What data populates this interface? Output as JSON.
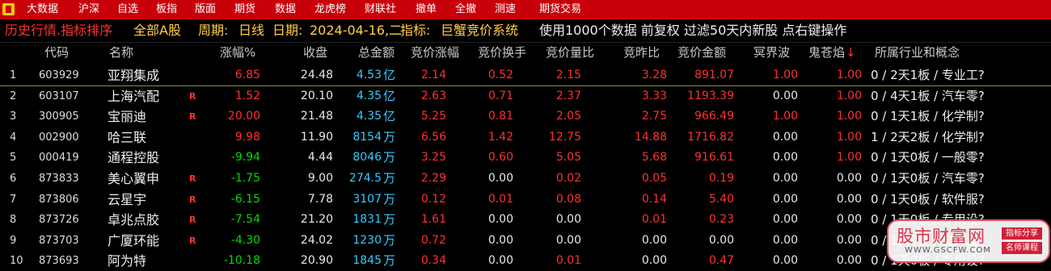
{
  "menu": [
    "大数据",
    "沪深",
    "自选",
    "板指",
    "版面",
    "期货",
    "数据",
    "龙虎榜",
    "财联社",
    "撤单",
    "全撤",
    "测速",
    "期货交易"
  ],
  "info": {
    "title": "历史行情.指标排序",
    "scope": "全部A股",
    "period_label": "周期:",
    "period_value": "日线",
    "date_label": "日期:",
    "date_value": "2024-04-16,二",
    "indicator_label": "指标:",
    "indicator_value": "巨蟹竞价系统",
    "usage": "使用1000个数据 前复权 过滤50天内新股 点右键操作"
  },
  "headers": {
    "code": "代码",
    "name": "名称",
    "change": "涨幅%",
    "close": "收盘",
    "amount": "总金额",
    "bid_change": "竞价涨幅",
    "bid_turnover": "竞价换手",
    "bid_volratio": "竞价量比",
    "bid_prevratio": "竞昨比",
    "bid_amount": "竞价金额",
    "wave": "冥界波",
    "flame": "鬼苍焰",
    "sort_arrow": "↓",
    "industry": "所属行业和概念"
  },
  "rows": [
    {
      "idx": "1",
      "code": "603929",
      "name": "亚翔集成",
      "r": "",
      "change": "6.85",
      "close": "24.48",
      "amount_num": "4.53",
      "amount_unit": "亿",
      "bid_change": "2.14",
      "bid_turnover": "0.52",
      "bid_volratio": "2.15",
      "bid_prevratio": "3.28",
      "bid_amount": "891.07",
      "wave": "1.00",
      "flame": "1.00",
      "industry": "0 / 2天1板 / 专业工?"
    },
    {
      "idx": "2",
      "code": "603107",
      "name": "上海汽配",
      "r": "R",
      "change": "1.52",
      "close": "20.10",
      "amount_num": "4.35",
      "amount_unit": "亿",
      "bid_change": "2.63",
      "bid_turnover": "0.71",
      "bid_volratio": "2.37",
      "bid_prevratio": "3.33",
      "bid_amount": "1193.39",
      "wave": "0.00",
      "flame": "1.00",
      "industry": "0 / 4天1板 / 汽车零?"
    },
    {
      "idx": "3",
      "code": "300905",
      "name": "宝丽迪",
      "r": "R",
      "change": "20.00",
      "close": "21.48",
      "amount_num": "4.35",
      "amount_unit": "亿",
      "bid_change": "5.25",
      "bid_turnover": "0.81",
      "bid_volratio": "2.05",
      "bid_prevratio": "2.75",
      "bid_amount": "966.49",
      "wave": "1.00",
      "flame": "1.00",
      "industry": "0 / 1天1板 / 化学制?"
    },
    {
      "idx": "4",
      "code": "002900",
      "name": "哈三联",
      "r": "",
      "change": "9.98",
      "close": "11.90",
      "amount_num": "8154",
      "amount_unit": "万",
      "bid_change": "6.56",
      "bid_turnover": "1.42",
      "bid_volratio": "12.75",
      "bid_prevratio": "14.88",
      "bid_amount": "1716.82",
      "wave": "0.00",
      "flame": "1.00",
      "industry": "1 / 2天2板 / 化学制?"
    },
    {
      "idx": "5",
      "code": "000419",
      "name": "通程控股",
      "r": "",
      "change": "-9.94",
      "close": "4.44",
      "amount_num": "8046",
      "amount_unit": "万",
      "bid_change": "3.25",
      "bid_turnover": "0.60",
      "bid_volratio": "5.05",
      "bid_prevratio": "5.68",
      "bid_amount": "916.61",
      "wave": "0.00",
      "flame": "1.00",
      "industry": "0 / 1天0板 / 一般零?"
    },
    {
      "idx": "6",
      "code": "873833",
      "name": "美心翼申",
      "r": "R",
      "change": "-1.75",
      "close": "9.00",
      "amount_num": "274.5",
      "amount_unit": "万",
      "bid_change": "2.29",
      "bid_turnover": "0.00",
      "bid_volratio": "0.02",
      "bid_prevratio": "0.05",
      "bid_amount": "0.19",
      "wave": "0.00",
      "flame": "0.00",
      "industry": "0 / 1天0板 / 汽车零?"
    },
    {
      "idx": "7",
      "code": "873806",
      "name": "云星宇",
      "r": "R",
      "change": "-6.15",
      "close": "7.78",
      "amount_num": "3107",
      "amount_unit": "万",
      "bid_change": "0.12",
      "bid_turnover": "0.01",
      "bid_volratio": "0.08",
      "bid_prevratio": "0.14",
      "bid_amount": "5.40",
      "wave": "0.00",
      "flame": "0.00",
      "industry": "0 / 1天0板 / 软件服?"
    },
    {
      "idx": "8",
      "code": "873726",
      "name": "卓兆点胶",
      "r": "R",
      "change": "-7.54",
      "close": "21.20",
      "amount_num": "1831",
      "amount_unit": "万",
      "bid_change": "1.61",
      "bid_turnover": "0.00",
      "bid_volratio": "0.00",
      "bid_prevratio": "0.01",
      "bid_amount": "0.23",
      "wave": "0.00",
      "flame": "0.00",
      "industry": "0 / 1天0板 / 专用设?"
    },
    {
      "idx": "9",
      "code": "873703",
      "name": "广厦环能",
      "r": "R",
      "change": "-4.30",
      "close": "24.02",
      "amount_num": "1230",
      "amount_unit": "万",
      "bid_change": "0.72",
      "bid_turnover": "0.00",
      "bid_volratio": "0.00",
      "bid_prevratio": "0.00",
      "bid_amount": "0.00",
      "wave": "0.00",
      "flame": "0.00",
      "industry": "0 / 1天0板 / 电力设?"
    },
    {
      "idx": "10",
      "code": "873693",
      "name": "阿为特",
      "r": "",
      "change": "-10.18",
      "close": "20.90",
      "amount_num": "1845",
      "amount_unit": "万",
      "bid_change": "0.34",
      "bid_turnover": "0.00",
      "bid_volratio": "0.01",
      "bid_prevratio": "0.00",
      "bid_amount": "0.47",
      "wave": "0.00",
      "flame": "0.00",
      "industry": "0 / 1天0板 / 专用设?"
    }
  ],
  "watermark": {
    "title": "股市财富网",
    "url": "WWW.GSCFW.COM",
    "tag1": "指标分享",
    "tag2": "名师课程"
  },
  "colors": {
    "menubar": "#c8000a",
    "up": "#ff3030",
    "down": "#00dd00",
    "flat": "#e8e8e8",
    "accent_cyan": "#33ccff",
    "label_yellow": "#ffcc44",
    "title_red": "#ff3030"
  }
}
